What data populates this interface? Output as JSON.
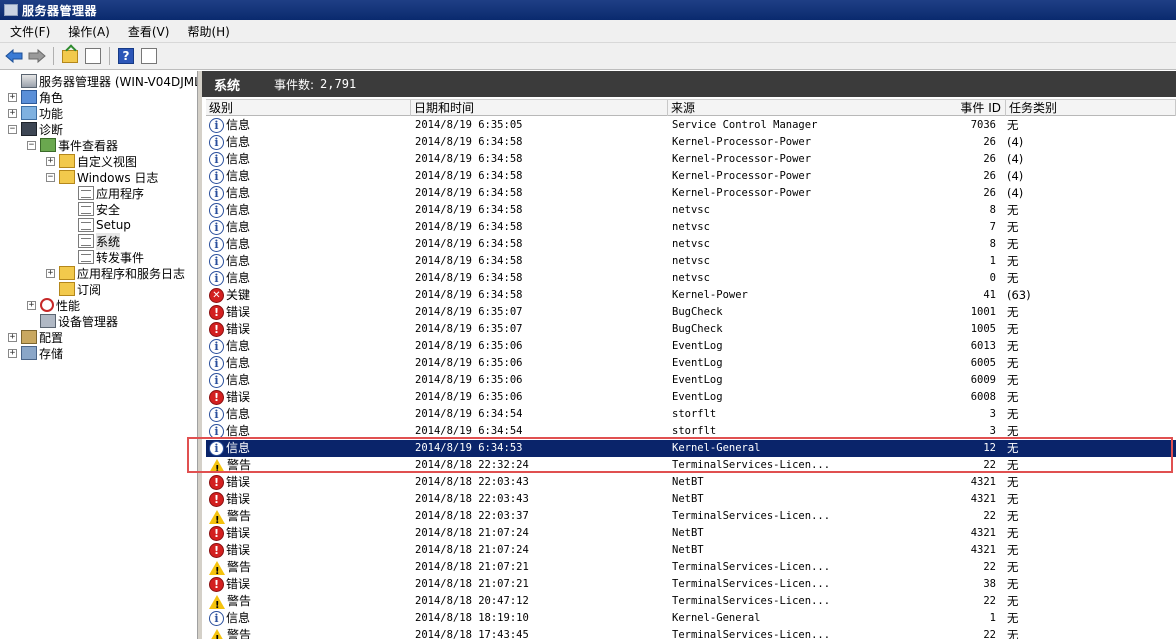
{
  "window": {
    "title": "服务器管理器"
  },
  "menu": [
    {
      "label": "文件(F)"
    },
    {
      "label": "操作(A)"
    },
    {
      "label": "查看(V)"
    },
    {
      "label": "帮助(H)"
    }
  ],
  "tree": [
    {
      "label": "服务器管理器 (WIN-V04DJMLR70",
      "depth": 0,
      "expander": "",
      "icon": "server-icon",
      "iconClass": "ico-server"
    },
    {
      "label": "角色",
      "depth": 0,
      "expander": "+",
      "icon": "roles-icon",
      "iconClass": "ico-role"
    },
    {
      "label": "功能",
      "depth": 0,
      "expander": "+",
      "icon": "features-icon",
      "iconClass": "ico-func"
    },
    {
      "label": "诊断",
      "depth": 0,
      "expander": "−",
      "icon": "diagnostics-icon",
      "iconClass": "ico-diag"
    },
    {
      "label": "事件查看器",
      "depth": 1,
      "expander": "−",
      "icon": "event-viewer-icon",
      "iconClass": "ico-viewer"
    },
    {
      "label": "自定义视图",
      "depth": 2,
      "expander": "+",
      "icon": "folder-icon",
      "iconClass": "ico-folder"
    },
    {
      "label": "Windows 日志",
      "depth": 2,
      "expander": "−",
      "icon": "folder-icon",
      "iconClass": "ico-folder"
    },
    {
      "label": "应用程序",
      "depth": 3,
      "expander": "",
      "icon": "log-icon",
      "iconClass": "ico-log"
    },
    {
      "label": "安全",
      "depth": 3,
      "expander": "",
      "icon": "log-icon",
      "iconClass": "ico-log"
    },
    {
      "label": "Setup",
      "depth": 3,
      "expander": "",
      "icon": "log-icon",
      "iconClass": "ico-log"
    },
    {
      "label": "系统",
      "depth": 3,
      "expander": "",
      "icon": "log-icon",
      "iconClass": "ico-log",
      "selected": true
    },
    {
      "label": "转发事件",
      "depth": 3,
      "expander": "",
      "icon": "log-icon",
      "iconClass": "ico-log"
    },
    {
      "label": "应用程序和服务日志",
      "depth": 2,
      "expander": "+",
      "icon": "folder-icon",
      "iconClass": "ico-folder"
    },
    {
      "label": "订阅",
      "depth": 2,
      "expander": "",
      "icon": "subscription-icon",
      "iconClass": "ico-folder"
    },
    {
      "label": "性能",
      "depth": 1,
      "expander": "+",
      "icon": "performance-icon",
      "iconClass": "ico-perf"
    },
    {
      "label": "设备管理器",
      "depth": 1,
      "expander": "",
      "icon": "device-manager-icon",
      "iconClass": "ico-dev"
    },
    {
      "label": "配置",
      "depth": 0,
      "expander": "+",
      "icon": "configuration-icon",
      "iconClass": "ico-config"
    },
    {
      "label": "存储",
      "depth": 0,
      "expander": "+",
      "icon": "storage-icon",
      "iconClass": "ico-storage"
    }
  ],
  "pane": {
    "title": "系统",
    "count_label": "事件数:",
    "count_value": "2,791"
  },
  "columns": [
    "级别",
    "日期和时间",
    "来源",
    "事件 ID",
    "任务类别"
  ],
  "events": [
    {
      "level": "info",
      "level_label": "信息",
      "date": "2014/8/19 6:35:05",
      "source": "Service Control Manager",
      "id": "7036",
      "task": "无"
    },
    {
      "level": "info",
      "level_label": "信息",
      "date": "2014/8/19 6:34:58",
      "source": "Kernel-Processor-Power",
      "id": "26",
      "task": "(4)"
    },
    {
      "level": "info",
      "level_label": "信息",
      "date": "2014/8/19 6:34:58",
      "source": "Kernel-Processor-Power",
      "id": "26",
      "task": "(4)"
    },
    {
      "level": "info",
      "level_label": "信息",
      "date": "2014/8/19 6:34:58",
      "source": "Kernel-Processor-Power",
      "id": "26",
      "task": "(4)"
    },
    {
      "level": "info",
      "level_label": "信息",
      "date": "2014/8/19 6:34:58",
      "source": "Kernel-Processor-Power",
      "id": "26",
      "task": "(4)"
    },
    {
      "level": "info",
      "level_label": "信息",
      "date": "2014/8/19 6:34:58",
      "source": "netvsc",
      "id": "8",
      "task": "无"
    },
    {
      "level": "info",
      "level_label": "信息",
      "date": "2014/8/19 6:34:58",
      "source": "netvsc",
      "id": "7",
      "task": "无"
    },
    {
      "level": "info",
      "level_label": "信息",
      "date": "2014/8/19 6:34:58",
      "source": "netvsc",
      "id": "8",
      "task": "无"
    },
    {
      "level": "info",
      "level_label": "信息",
      "date": "2014/8/19 6:34:58",
      "source": "netvsc",
      "id": "1",
      "task": "无"
    },
    {
      "level": "info",
      "level_label": "信息",
      "date": "2014/8/19 6:34:58",
      "source": "netvsc",
      "id": "0",
      "task": "无"
    },
    {
      "level": "critical",
      "level_label": "关键",
      "date": "2014/8/19 6:34:58",
      "source": "Kernel-Power",
      "id": "41",
      "task": "(63)"
    },
    {
      "level": "error",
      "level_label": "错误",
      "date": "2014/8/19 6:35:07",
      "source": "BugCheck",
      "id": "1001",
      "task": "无"
    },
    {
      "level": "error",
      "level_label": "错误",
      "date": "2014/8/19 6:35:07",
      "source": "BugCheck",
      "id": "1005",
      "task": "无"
    },
    {
      "level": "info",
      "level_label": "信息",
      "date": "2014/8/19 6:35:06",
      "source": "EventLog",
      "id": "6013",
      "task": "无"
    },
    {
      "level": "info",
      "level_label": "信息",
      "date": "2014/8/19 6:35:06",
      "source": "EventLog",
      "id": "6005",
      "task": "无"
    },
    {
      "level": "info",
      "level_label": "信息",
      "date": "2014/8/19 6:35:06",
      "source": "EventLog",
      "id": "6009",
      "task": "无"
    },
    {
      "level": "error",
      "level_label": "错误",
      "date": "2014/8/19 6:35:06",
      "source": "EventLog",
      "id": "6008",
      "task": "无"
    },
    {
      "level": "info",
      "level_label": "信息",
      "date": "2014/8/19 6:34:54",
      "source": "storflt",
      "id": "3",
      "task": "无"
    },
    {
      "level": "info",
      "level_label": "信息",
      "date": "2014/8/19 6:34:54",
      "source": "storflt",
      "id": "3",
      "task": "无"
    },
    {
      "level": "info",
      "level_label": "信息",
      "date": "2014/8/19 6:34:53",
      "source": "Kernel-General",
      "id": "12",
      "task": "无",
      "selected": true
    },
    {
      "level": "warn",
      "level_label": "警告",
      "date": "2014/8/18 22:32:24",
      "source": "TerminalServices-Licen...",
      "id": "22",
      "task": "无"
    },
    {
      "level": "error",
      "level_label": "错误",
      "date": "2014/8/18 22:03:43",
      "source": "NetBT",
      "id": "4321",
      "task": "无"
    },
    {
      "level": "error",
      "level_label": "错误",
      "date": "2014/8/18 22:03:43",
      "source": "NetBT",
      "id": "4321",
      "task": "无"
    },
    {
      "level": "warn",
      "level_label": "警告",
      "date": "2014/8/18 22:03:37",
      "source": "TerminalServices-Licen...",
      "id": "22",
      "task": "无"
    },
    {
      "level": "error",
      "level_label": "错误",
      "date": "2014/8/18 21:07:24",
      "source": "NetBT",
      "id": "4321",
      "task": "无"
    },
    {
      "level": "error",
      "level_label": "错误",
      "date": "2014/8/18 21:07:24",
      "source": "NetBT",
      "id": "4321",
      "task": "无"
    },
    {
      "level": "warn",
      "level_label": "警告",
      "date": "2014/8/18 21:07:21",
      "source": "TerminalServices-Licen...",
      "id": "22",
      "task": "无"
    },
    {
      "level": "error",
      "level_label": "错误",
      "date": "2014/8/18 21:07:21",
      "source": "TerminalServices-Licen...",
      "id": "38",
      "task": "无"
    },
    {
      "level": "warn",
      "level_label": "警告",
      "date": "2014/8/18 20:47:12",
      "source": "TerminalServices-Licen...",
      "id": "22",
      "task": "无"
    },
    {
      "level": "info",
      "level_label": "信息",
      "date": "2014/8/18 18:19:10",
      "source": "Kernel-General",
      "id": "1",
      "task": "无"
    },
    {
      "level": "warn",
      "level_label": "警告",
      "date": "2014/8/18 17:43:45",
      "source": "TerminalServices-Licen...",
      "id": "22",
      "task": "无"
    }
  ]
}
